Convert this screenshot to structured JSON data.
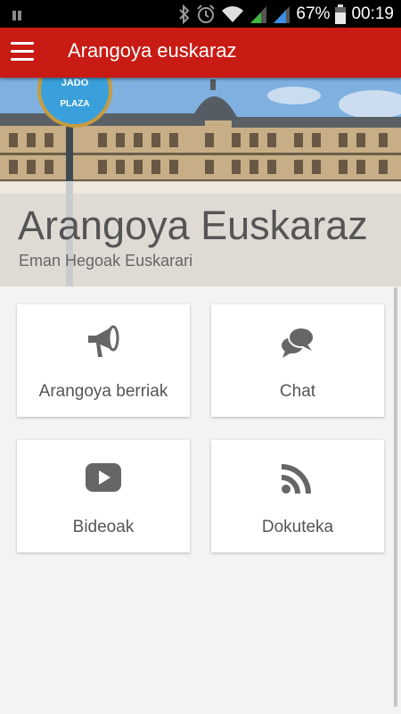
{
  "status_bar": {
    "battery_percent": "67%",
    "time": "00:19",
    "icons": [
      "notification-icon",
      "bluetooth-icon",
      "alarm-icon",
      "wifi-icon",
      "signal-icon",
      "signal-icon-2",
      "battery-icon"
    ]
  },
  "app_bar": {
    "title": "Arangoya euskaraz",
    "menu_icon": "hamburger-menu-icon"
  },
  "hero": {
    "title": "Arangoya Euskaraz",
    "subtitle": "Eman Hegoak Euskarari",
    "sign_text": [
      "JADO",
      "PLAZA"
    ]
  },
  "cards": [
    {
      "label": "Arangoya berriak",
      "icon": "megaphone-icon"
    },
    {
      "label": "Chat",
      "icon": "chat-bubbles-icon"
    },
    {
      "label": "Bideoak",
      "icon": "youtube-play-icon"
    },
    {
      "label": "Dokuteka",
      "icon": "rss-feed-icon"
    }
  ],
  "colors": {
    "app_bar": "#c81b14",
    "background": "#f3f3f3",
    "card": "#ffffff",
    "icon": "#666666",
    "text": "#555555"
  }
}
